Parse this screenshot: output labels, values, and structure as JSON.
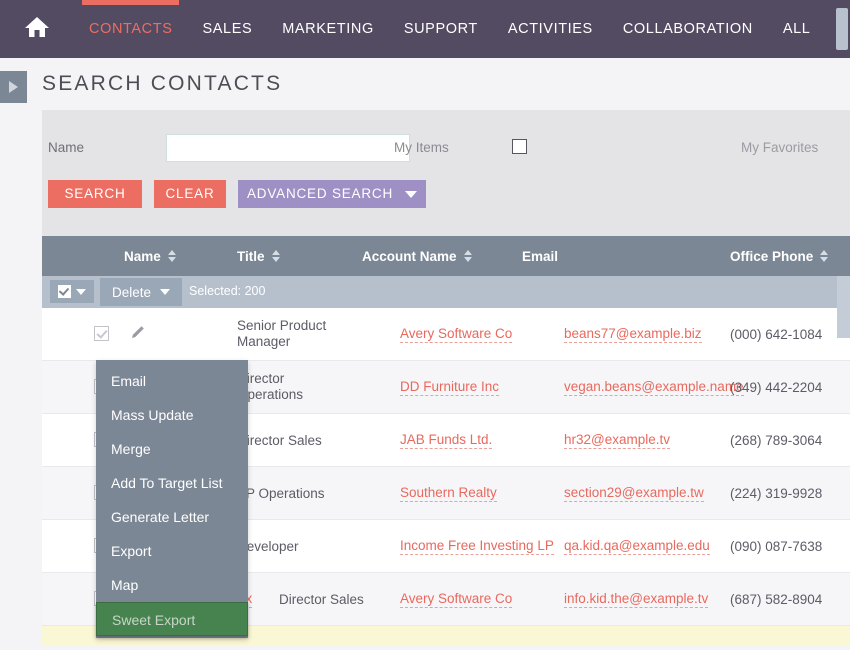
{
  "nav": {
    "home_icon": "home-icon",
    "items": [
      {
        "label": "CONTACTS",
        "active": true
      },
      {
        "label": "SALES",
        "active": false
      },
      {
        "label": "MARKETING",
        "active": false
      },
      {
        "label": "SUPPORT",
        "active": false
      },
      {
        "label": "ACTIVITIES",
        "active": false
      },
      {
        "label": "COLLABORATION",
        "active": false
      },
      {
        "label": "ALL",
        "active": false
      }
    ]
  },
  "page": {
    "title": "SEARCH CONTACTS",
    "side_toggle_icon": "expand-triangle-icon"
  },
  "search": {
    "name_label": "Name",
    "name_value": "",
    "name_placeholder": "",
    "my_items_label": "My Items",
    "my_items_checked": false,
    "my_favorites_label": "My Favorites",
    "search_button": "SEARCH",
    "clear_button": "CLEAR",
    "advanced_button": "ADVANCED SEARCH",
    "advanced_caret_icon": "caret-down-icon"
  },
  "list": {
    "columns": [
      {
        "label": "Name",
        "sortable": true
      },
      {
        "label": "Title",
        "sortable": true
      },
      {
        "label": "Account Name",
        "sortable": true
      },
      {
        "label": "Email",
        "sortable": false
      },
      {
        "label": "Office Phone",
        "sortable": true
      }
    ],
    "massbar": {
      "select_all_icon": "checkbox-checked-icon",
      "select_all_caret_icon": "caret-down-icon",
      "delete_label": "Delete",
      "delete_caret_icon": "caret-down-icon",
      "selected_label": "Selected: 200"
    },
    "rows": [
      {
        "checked": true,
        "edit_icon": "pencil-icon",
        "name": "",
        "title": "Senior Product Manager",
        "title_line1": "Senior Product",
        "title_line2": "Manager",
        "account": "Avery Software Co",
        "email": "beans77@example.biz",
        "phone": "(000) 642-1084"
      },
      {
        "checked": true,
        "edit_icon": "pencil-icon",
        "name": "",
        "title": "Director Operations",
        "title_line1": "Director",
        "title_line2": "Operations",
        "account": "DD Furniture Inc",
        "email": "vegan.beans@example.name",
        "phone": "(349) 442-2204"
      },
      {
        "checked": true,
        "edit_icon": "pencil-icon",
        "name": "",
        "title": "Director Sales",
        "title_line1": "Director Sales",
        "title_line2": "",
        "account": "JAB Funds Ltd.",
        "email": "hr32@example.tv",
        "phone": "(268) 789-3064"
      },
      {
        "checked": true,
        "edit_icon": "pencil-icon",
        "name": "",
        "title": "VP Operations",
        "title_line1": "VP Operations",
        "title_line2": "",
        "account": "Southern Realty",
        "email": "section29@example.tw",
        "phone": "(224) 319-9928"
      },
      {
        "checked": true,
        "edit_icon": "pencil-icon",
        "name": "",
        "title": "Developer",
        "title_line1": "Developer",
        "title_line2": "",
        "account": "Income Free Investing LP",
        "email": "qa.kid.qa@example.edu",
        "phone": "(090) 087-7638"
      },
      {
        "checked": true,
        "edit_icon": "pencil-icon",
        "name": "Eli Lamoureux",
        "title": "Director Sales",
        "title_line1": "Director Sales",
        "title_line2": "",
        "account": "Avery Software Co",
        "email": "info.kid.the@example.tv",
        "phone": "(687) 582-8904"
      }
    ]
  },
  "menu": {
    "items": [
      {
        "label": "Email",
        "selected": false
      },
      {
        "label": "Mass Update",
        "selected": false
      },
      {
        "label": "Merge",
        "selected": false
      },
      {
        "label": "Add To Target List",
        "selected": false
      },
      {
        "label": "Generate Letter",
        "selected": false
      },
      {
        "label": "Export",
        "selected": false
      },
      {
        "label": "Map",
        "selected": false
      },
      {
        "label": "Sweet Export",
        "selected": true
      }
    ]
  },
  "colors": {
    "navbar": "#534b62",
    "accent": "#ec6e62",
    "advanced": "#9e8fc4",
    "table_header": "#7c8795",
    "massbar": "#b6c0cc",
    "link": "#e8695e",
    "menu_selected": "#46834e",
    "row_highlight": "#faf7d4"
  }
}
